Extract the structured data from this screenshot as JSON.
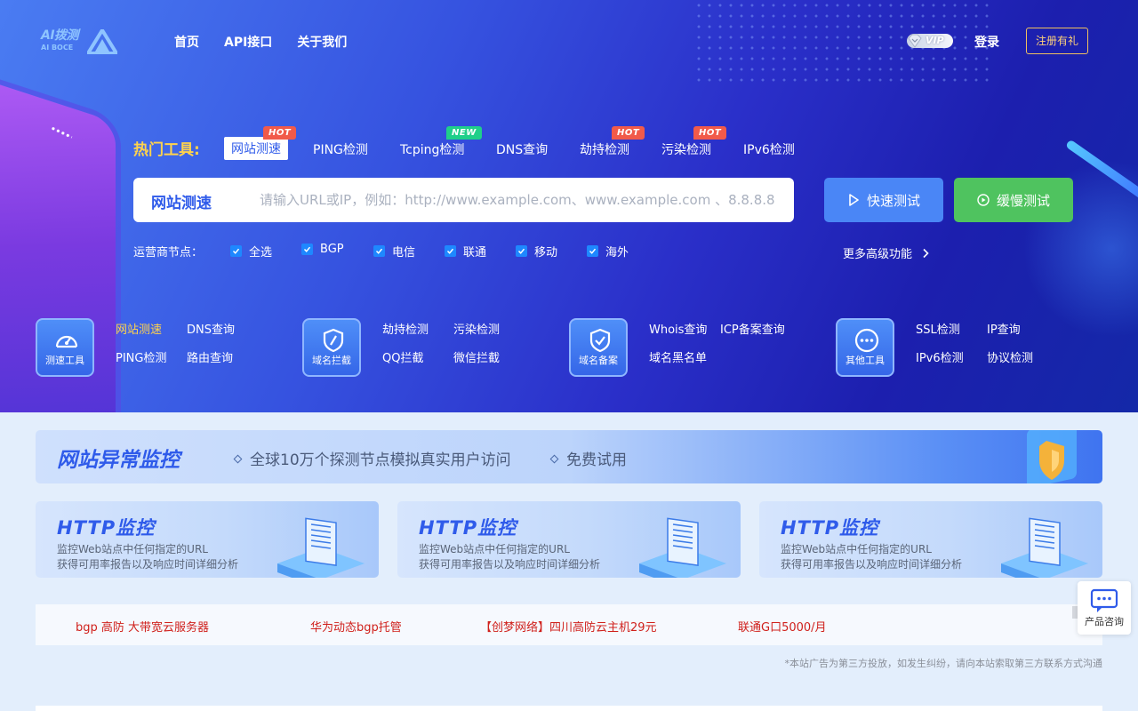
{
  "logo": {
    "text": "AI拨测",
    "sub": "AI BOCE"
  },
  "nav": {
    "items": [
      "首页",
      "API接口",
      "关于我们"
    ]
  },
  "header": {
    "vip": "VIP",
    "login": "登录",
    "register": "注册有礼"
  },
  "tools": {
    "label": "热门工具:",
    "tabs": [
      {
        "label": "网站测速",
        "badge": "HOT"
      },
      {
        "label": "PING检测",
        "badge": ""
      },
      {
        "label": "Tcping检测",
        "badge": "NEW"
      },
      {
        "label": "DNS查询",
        "badge": ""
      },
      {
        "label": "劫持检测",
        "badge": "HOT"
      },
      {
        "label": "污染检测",
        "badge": "HOT"
      },
      {
        "label": "IPv6检测",
        "badge": ""
      }
    ]
  },
  "search": {
    "mode": "网站测速",
    "placeholder": "请输入URL或IP，例如：http://www.example.com、www.example.com 、8.8.8.8",
    "value": "",
    "fast_button": "快速测试",
    "slow_button": "缓慢测试"
  },
  "nodes": {
    "label": "运营商节点：",
    "options": [
      "全选",
      "BGP",
      "电信",
      "联通",
      "移动",
      "海外"
    ],
    "more": "更多高级功能"
  },
  "categories": [
    {
      "label": "测速工具",
      "icon": "speedometer-icon",
      "links": [
        "网站测速",
        "DNS查询",
        "PING检测",
        "路由查询"
      ]
    },
    {
      "label": "域名拦截",
      "icon": "shield-slash-icon",
      "links": [
        "劫持检测",
        "污染检测",
        "QQ拦截",
        "微信拦截"
      ]
    },
    {
      "label": "域名备案",
      "icon": "shield-check-icon",
      "links": [
        "Whois查询",
        "ICP备案查询",
        "域名黑名单"
      ]
    },
    {
      "label": "其他工具",
      "icon": "more-icon",
      "links": [
        "SSL检测",
        "IP查询",
        "IPv6检测",
        "协议检测"
      ]
    }
  ],
  "monitor": {
    "title": "网站异常监控",
    "items": [
      "全球10万个探测节点模拟真实用户访问",
      "免费试用"
    ]
  },
  "http_cards": [
    {
      "title": "HTTP监控",
      "line1": "监控Web站点中任何指定的URL",
      "line2": "获得可用率报告以及响应时间详细分析"
    },
    {
      "title": "HTTP监控",
      "line1": "监控Web站点中任何指定的URL",
      "line2": "获得可用率报告以及响应时间详细分析"
    },
    {
      "title": "HTTP监控",
      "line1": "监控Web站点中任何指定的URL",
      "line2": "获得可用率报告以及响应时间详细分析"
    }
  ],
  "ads": {
    "items": [
      "bgp 高防 大带宽云服务器",
      "华为动态bgp托管",
      "【创梦网络】四川高防云主机29元",
      "联通G口5000/月"
    ],
    "note": "*本站广告为第三方投放，如发生纠纷，请向本站索取第三方联系方式沟通"
  },
  "consult": {
    "label": "产品咨询"
  },
  "colors": {
    "accent": "#2f5bea",
    "hot": "#f15a4a",
    "new": "#1fcf8a",
    "fast": "#4a86f6",
    "slow": "#4fc35f",
    "highlight": "#ffd34d",
    "ad": "#d0211c"
  }
}
